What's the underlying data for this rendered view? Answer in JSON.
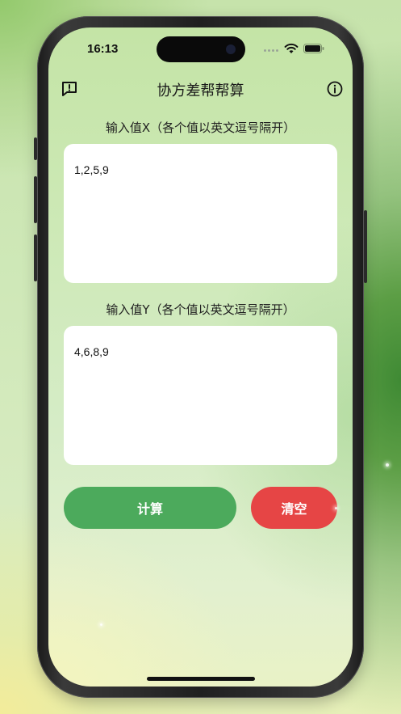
{
  "status_bar": {
    "time": "16:13"
  },
  "header": {
    "title": "协方差帮帮算",
    "left_icon": "feedback-icon",
    "right_icon": "info-icon"
  },
  "form": {
    "x_label": "输入值X（各个值以英文逗号隔开）",
    "x_value": "1,2,5,9",
    "y_label": "输入值Y（各个值以英文逗号隔开）",
    "y_value": "4,6,8,9"
  },
  "actions": {
    "calculate_label": "计算",
    "clear_label": "清空"
  },
  "colors": {
    "calculate_button": "#4caa5c",
    "clear_button": "#e64545",
    "input_background": "#ffffff"
  }
}
